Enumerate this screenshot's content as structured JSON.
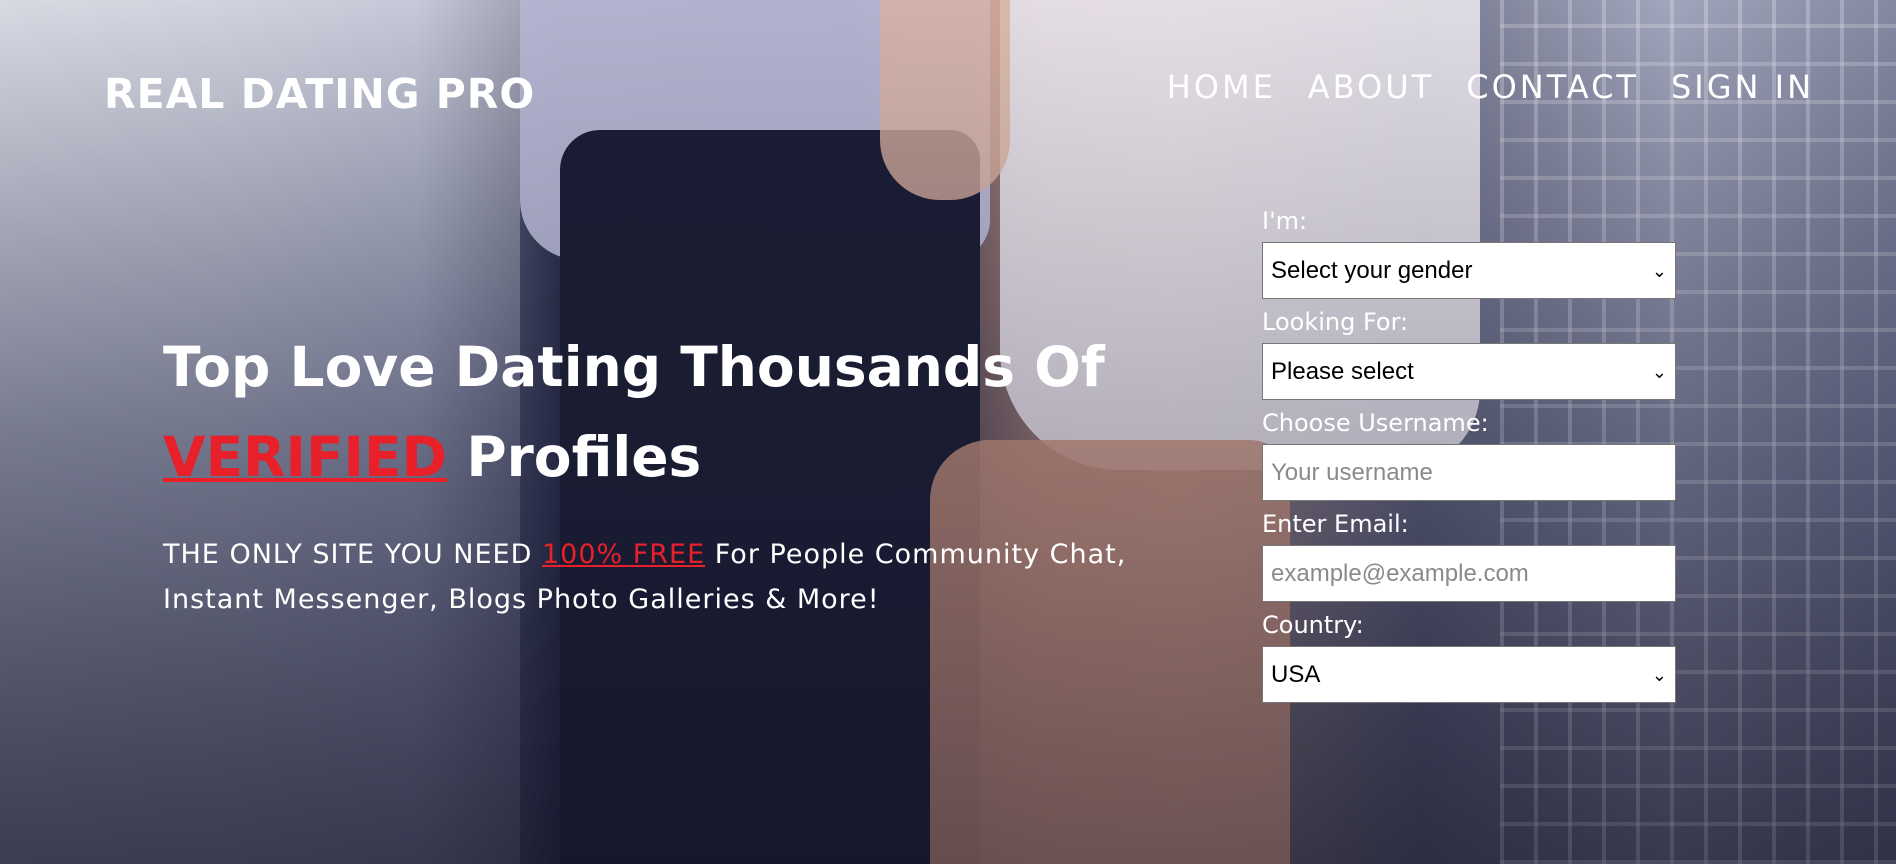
{
  "brand": {
    "logo": "REAL DATING PRO"
  },
  "nav": {
    "items": [
      {
        "label": "HOME"
      },
      {
        "label": "ABOUT"
      },
      {
        "label": "CONTACT"
      },
      {
        "label": "SIGN IN"
      }
    ]
  },
  "hero": {
    "headline_part1": "Top Love Dating Thousands Of",
    "headline_accent": "VERIFIED",
    "headline_part2": " Profiles",
    "subtext_part1": "THE ONLY SITE YOU NEED ",
    "subtext_accent": "100% FREE",
    "subtext_part2": " For People Community Chat, Instant Messenger, Blogs Photo Galleries & More!",
    "accent_color": "#e8202a"
  },
  "form": {
    "gender_label": "I'm:",
    "gender_value": "Select your gender",
    "looking_label": "Looking For:",
    "looking_value": "Please select",
    "username_label": "Choose Username:",
    "username_placeholder": "Your username",
    "email_label": "Enter Email:",
    "email_placeholder": "example@example.com",
    "country_label": "Country:",
    "country_value": "USA"
  },
  "icons": {
    "select_arrow": "chevron-down-icon"
  }
}
